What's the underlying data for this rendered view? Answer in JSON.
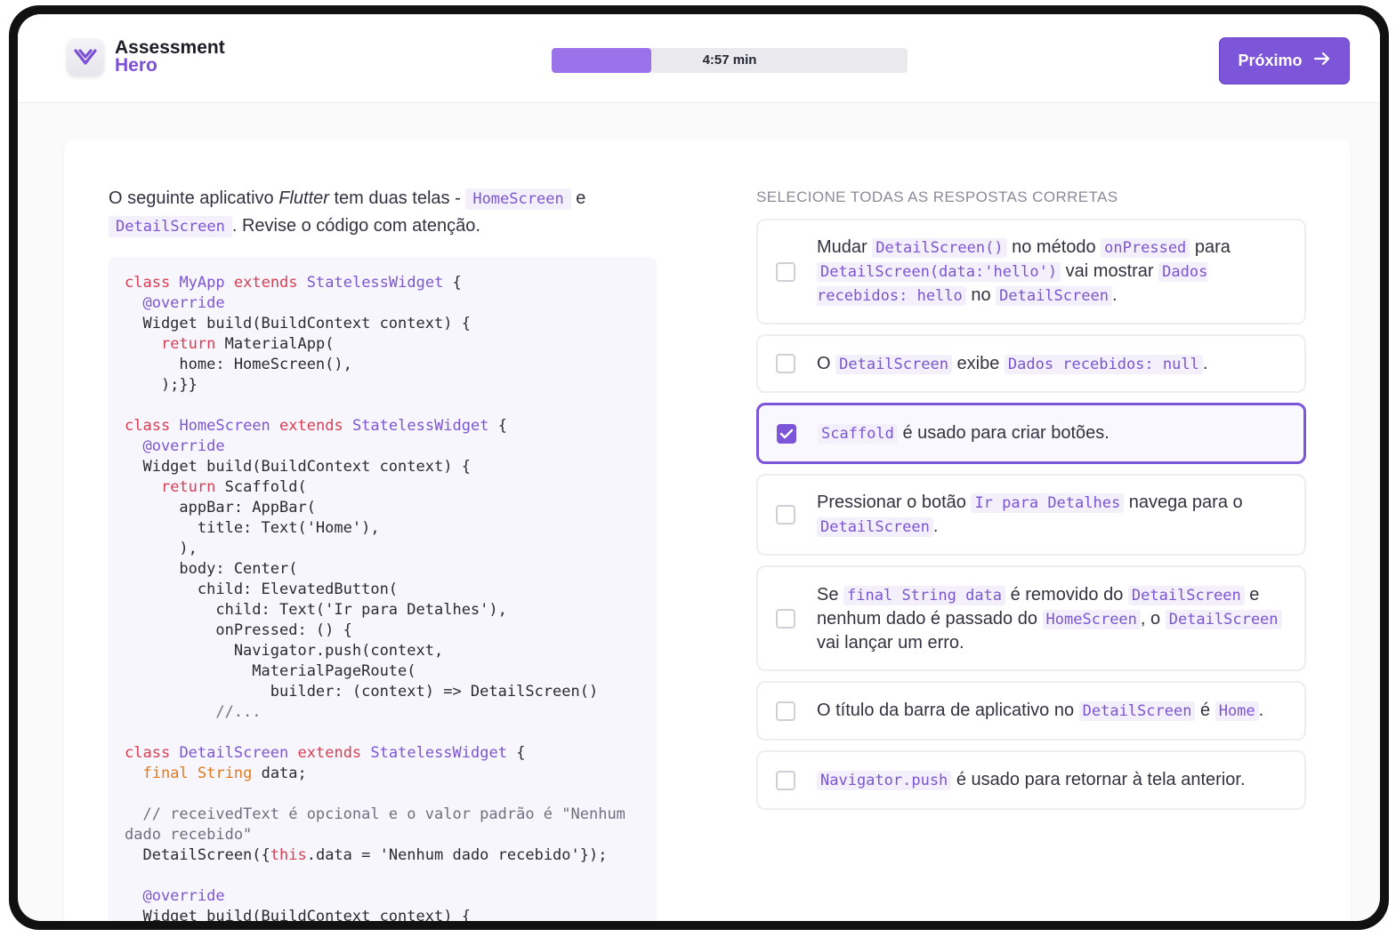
{
  "header": {
    "logo_line1": "Assessment",
    "logo_line2": "Hero",
    "timer_label": "4:57 min",
    "timer_progress": 0.28,
    "next_label": "Próximo"
  },
  "question": {
    "p1": "O seguinte aplicativo ",
    "p1_em": "Flutter",
    "p2": " tem duas telas - ",
    "c1": "HomeScreen",
    "p3": " e ",
    "c2": "DetailScreen",
    "p4": ". Revise o código com atenção."
  },
  "options_title": "SELECIONE TODAS AS RESPOSTAS CORRETAS",
  "options": [
    {
      "selected": false,
      "parts": {
        "a": "Mudar ",
        "b": "DetailScreen()",
        "c": " no método ",
        "d": "onPressed",
        "e": " para ",
        "f": "DetailScreen(data:'hello')",
        "g": " vai mostrar ",
        "h": "Dados recebidos: hello",
        "i": " no ",
        "j": "DetailScreen",
        "k": "."
      }
    },
    {
      "selected": false,
      "parts": {
        "a": "O ",
        "b": "DetailScreen",
        "c": " exibe ",
        "d": "Dados recebidos: null",
        "e": "."
      }
    },
    {
      "selected": true,
      "parts": {
        "a": "Scaffold",
        "b": " é usado para criar botões."
      }
    },
    {
      "selected": false,
      "parts": {
        "a": "Pressionar o botão ",
        "b": "Ir para Detalhes",
        "c": " navega para o ",
        "d": "DetailScreen",
        "e": "."
      }
    },
    {
      "selected": false,
      "parts": {
        "a": "Se ",
        "b": "final String data",
        "c": " é removido do ",
        "d": "DetailScreen",
        "e": " e nenhum dado é passado do ",
        "f": "HomeScreen",
        "g": ", o ",
        "h": "DetailScreen",
        "i": " vai lançar um erro."
      }
    },
    {
      "selected": false,
      "parts": {
        "a": "O título da barra de aplicativo no ",
        "b": "DetailScreen",
        "c": " é ",
        "d": "Home",
        "e": "."
      }
    },
    {
      "selected": false,
      "parts": {
        "a": "Navigator.push",
        "b": " é usado para retornar à tela anterior."
      }
    }
  ],
  "code": {
    "l1": {
      "a": "class",
      "b": " ",
      "c": "MyApp",
      "d": " ",
      "e": "extends",
      "f": " ",
      "g": "StatelessWidget",
      "h": " {"
    },
    "l2": "  @override",
    "l3": "  Widget build(BuildContext context) {",
    "l4": {
      "a": "    ",
      "b": "return",
      "c": " MaterialApp("
    },
    "l5": "      home: HomeScreen(),",
    "l6": "    );}}",
    "l7": {
      "a": "class",
      "b": " ",
      "c": "HomeScreen",
      "d": " ",
      "e": "extends",
      "f": " ",
      "g": "StatelessWidget",
      "h": " {"
    },
    "l8": "  @override",
    "l9": "  Widget build(BuildContext context) {",
    "l10": {
      "a": "    ",
      "b": "return",
      "c": " Scaffold("
    },
    "l11": "      appBar: AppBar(",
    "l12": "        title: Text('Home'),",
    "l13": "      ),",
    "l14": "      body: Center(",
    "l15": "        child: ElevatedButton(",
    "l16": "          child: Text('Ir para Detalhes'),",
    "l17": "          onPressed: () {",
    "l18": "            Navigator.push(context,",
    "l19": "              MaterialPageRoute(",
    "l20": "                builder: (context) => DetailScreen()",
    "l21": "          //...",
    "l22": {
      "a": "class",
      "b": " ",
      "c": "DetailScreen",
      "d": " ",
      "e": "extends",
      "f": " ",
      "g": "StatelessWidget",
      "h": " {"
    },
    "l23": {
      "a": "  ",
      "b": "final",
      "c": " ",
      "d": "String",
      "e": " data;"
    },
    "l24": "  // receivedText é opcional e o valor padrão é \"Nenhum\ndado recebido\"",
    "l25": {
      "a": "  DetailScreen({",
      "b": "this",
      "c": ".data = 'Nenhum dado recebido'});"
    },
    "l26": "  @override",
    "l27": "  Widget build(BuildContext context) {"
  },
  "colors": {
    "accent": "#7d55d8",
    "timer_fill": "#9b72ea",
    "keyword": "#d63f53",
    "code_type": "#e07a1f"
  },
  "icons": {
    "logo": "hero-logo-icon",
    "next": "arrow-right-icon",
    "check": "checkmark-icon"
  }
}
